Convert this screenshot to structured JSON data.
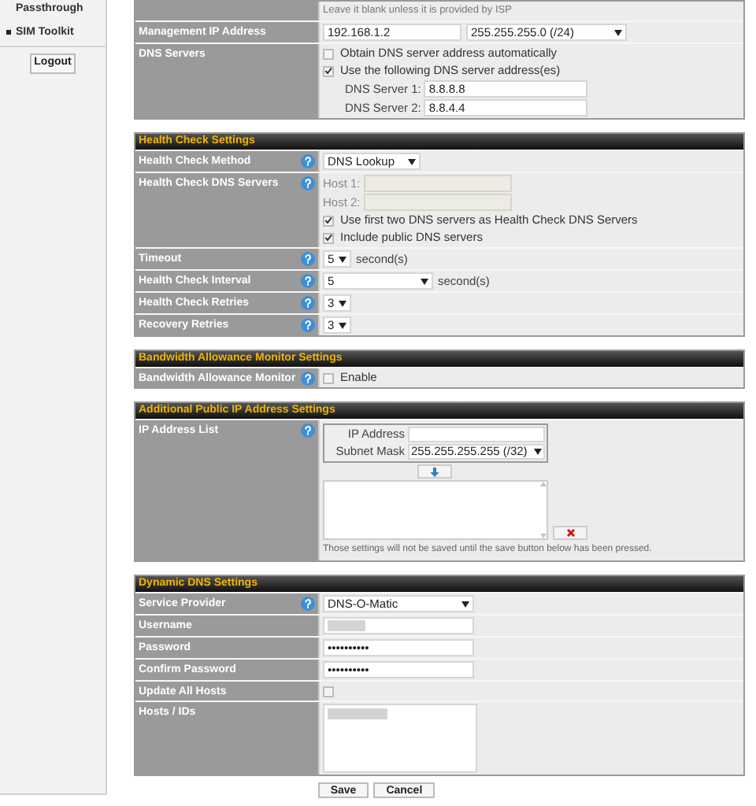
{
  "sidebar": {
    "items": [
      {
        "label": "Passthrough",
        "bullet": false
      },
      {
        "label": "SIM Toolkit",
        "bullet": true
      }
    ],
    "logout": "Logout"
  },
  "sections": [
    {
      "rows": [
        {
          "help": false,
          "lines": [
            [
              {
                "kind": "note",
                "text": "Leave it blank unless it is provided by ISP"
              }
            ]
          ]
        },
        {
          "label": "Management IP Address",
          "help": false,
          "lines": [
            [
              {
                "kind": "input",
                "value": "192.168.1.2"
              },
              {
                "kind": "select",
                "value": "255.255.255.0 (/24)"
              }
            ]
          ]
        },
        {
          "label": "DNS Servers",
          "help": false,
          "lines": [
            [
              {
                "kind": "checkbox",
                "label": "Obtain DNS server address automatically",
                "checked": false
              }
            ],
            [
              {
                "kind": "checkbox",
                "label": "Use the following DNS server address(es)",
                "checked": true
              }
            ],
            [
              {
                "kind": "labeled_input",
                "label": "DNS Server 1:",
                "value": "8.8.8.8",
                "disabled": false
              }
            ],
            [
              {
                "kind": "labeled_input",
                "label": "DNS Server 2:",
                "value": "8.8.4.4",
                "disabled": false
              }
            ]
          ]
        }
      ]
    },
    {
      "title": "Health Check Settings",
      "rows": [
        {
          "label": "Health Check Method",
          "help": true,
          "lines": [
            [
              {
                "kind": "select",
                "value": "DNS Lookup"
              }
            ]
          ]
        },
        {
          "label": "Health Check DNS Servers",
          "help": true,
          "lines": [
            [
              {
                "kind": "labeled_input",
                "label": "Host 1:",
                "disabled": true
              }
            ],
            [
              {
                "kind": "labeled_input",
                "label": "Host 2:",
                "disabled": true
              }
            ],
            [
              {
                "kind": "checkbox",
                "label": "Use first two DNS servers as Health Check DNS Servers",
                "checked": true
              }
            ],
            [
              {
                "kind": "checkbox",
                "label": "Include public DNS servers",
                "checked": true
              }
            ]
          ]
        },
        {
          "label": "Timeout",
          "help": true,
          "lines": [
            [
              {
                "kind": "select",
                "value": "5"
              },
              {
                "kind": "unit",
                "text": "second(s)"
              }
            ]
          ]
        },
        {
          "label": "Health Check Interval",
          "help": true,
          "lines": [
            [
              {
                "kind": "select",
                "value": "5"
              },
              {
                "kind": "unit",
                "text": "second(s)"
              }
            ]
          ]
        },
        {
          "label": "Health Check Retries",
          "help": true,
          "lines": [
            [
              {
                "kind": "select",
                "value": "3"
              }
            ]
          ]
        },
        {
          "label": "Recovery Retries",
          "help": true,
          "lines": [
            [
              {
                "kind": "select",
                "value": "3"
              }
            ]
          ]
        }
      ]
    },
    {
      "title": "Bandwidth Allowance Monitor Settings",
      "rows": [
        {
          "label": "Bandwidth Allowance Monitor",
          "help": true,
          "lines": [
            [
              {
                "kind": "checkbox",
                "label": "Enable",
                "checked": false
              }
            ]
          ]
        }
      ]
    },
    {
      "title": "Additional Public IP Address Settings",
      "rows": [
        {
          "label": "IP Address List",
          "help": true,
          "lines": [
            [
              {
                "kind": "ip_list",
                "ip_label": "IP Address",
                "mask_label": "Subnet Mask",
                "mask_value": "255.255.255.255 (/32)",
                "note": "Those settings will not be saved until the save button below has been pressed."
              }
            ]
          ]
        }
      ]
    },
    {
      "title": "Dynamic DNS Settings",
      "rows": [
        {
          "label": "Service Provider",
          "help": true,
          "lines": [
            [
              {
                "kind": "select",
                "value": "DNS-O-Matic"
              }
            ]
          ]
        },
        {
          "label": "Username",
          "help": false,
          "lines": [
            [
              {
                "kind": "input",
                "redacted": true
              }
            ]
          ]
        },
        {
          "label": "Password",
          "help": false,
          "lines": [
            [
              {
                "kind": "input",
                "value": "••••••••••"
              }
            ]
          ]
        },
        {
          "label": "Confirm Password",
          "help": false,
          "lines": [
            [
              {
                "kind": "input",
                "value": "••••••••••"
              }
            ]
          ]
        },
        {
          "label": "Update All Hosts",
          "help": false,
          "lines": [
            [
              {
                "kind": "checkbox",
                "checked": false
              }
            ]
          ]
        },
        {
          "label": "Hosts / IDs",
          "help": false,
          "lines": [
            [
              {
                "kind": "textarea",
                "redacted": true
              }
            ]
          ]
        }
      ]
    }
  ],
  "buttons": [
    "Save",
    "Cancel"
  ]
}
